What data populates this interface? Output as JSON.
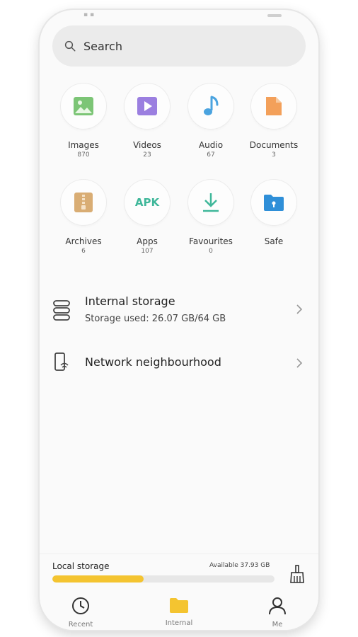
{
  "search": {
    "placeholder": "Search"
  },
  "categories": [
    {
      "name": "Images",
      "count": "870",
      "icon": "image-icon",
      "color": "#7cc576"
    },
    {
      "name": "Videos",
      "count": "23",
      "icon": "play-icon",
      "color": "#9b7fe0"
    },
    {
      "name": "Audio",
      "count": "67",
      "icon": "music-note-icon",
      "color": "#4aa3df"
    },
    {
      "name": "Documents",
      "count": "3",
      "icon": "document-icon",
      "color": "#f3a05a"
    },
    {
      "name": "Archives",
      "count": "6",
      "icon": "archive-icon",
      "color": "#d9ad74"
    },
    {
      "name": "Apps",
      "count": "107",
      "icon": "apk-icon",
      "color": "#3fb79a",
      "icon_text": "APK"
    },
    {
      "name": "Favourites",
      "count": "0",
      "icon": "download-icon",
      "color": "#3fb79a"
    },
    {
      "name": "Safe",
      "count": "",
      "icon": "safe-folder-icon",
      "color": "#2f8fd8"
    }
  ],
  "storage": {
    "title": "Internal storage",
    "subtitle": "Storage used: 26.07 GB/64 GB"
  },
  "network": {
    "title": "Network neighbourhood"
  },
  "local_storage": {
    "label": "Local storage",
    "available": "Available 37.93 GB",
    "used_fraction": 0.41
  },
  "nav": [
    {
      "label": "Recent",
      "icon": "clock-icon"
    },
    {
      "label": "Internal",
      "icon": "folder-icon",
      "active": true
    },
    {
      "label": "Me",
      "icon": "person-icon"
    }
  ],
  "colors": {
    "accent": "#f4c430",
    "folder_active": "#f4c430"
  }
}
